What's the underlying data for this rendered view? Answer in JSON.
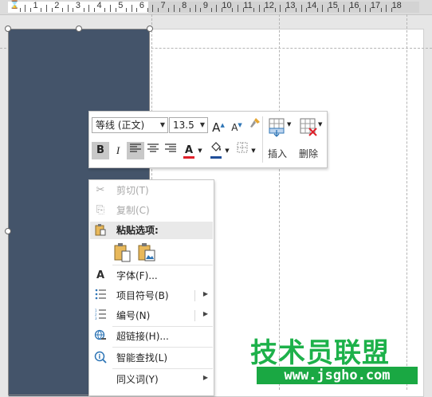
{
  "ruler": {
    "numbers": [
      "1",
      "2",
      "3",
      "4",
      "5",
      "6",
      "7",
      "8",
      "9",
      "10",
      "11",
      "12",
      "13",
      "14",
      "15",
      "16",
      "17",
      "18"
    ]
  },
  "mini_toolbar": {
    "font_name": "等线 (正文)",
    "font_size": "13.5",
    "insert_label": "插入",
    "delete_label": "删除",
    "bold_label": "B",
    "italic_label": "I",
    "font_color_letter": "A",
    "font_color": "#e0202a",
    "highlight_color": "#1f4e9a"
  },
  "context_menu": {
    "cut": "剪切(T)",
    "copy": "复制(C)",
    "paste_options": "粘贴选项:",
    "font": "字体(F)...",
    "bullets": "项目符号(B)",
    "numbering": "编号(N)",
    "hyperlink": "超链接(H)...",
    "smart_lookup": "智能查找(L)",
    "synonyms": "同义词(Y)"
  },
  "shape": {
    "fill_color": "#44546a"
  },
  "watermark": {
    "main": "技术员联盟",
    "url": "www.jsgho.com",
    "color": "#1db14a"
  }
}
